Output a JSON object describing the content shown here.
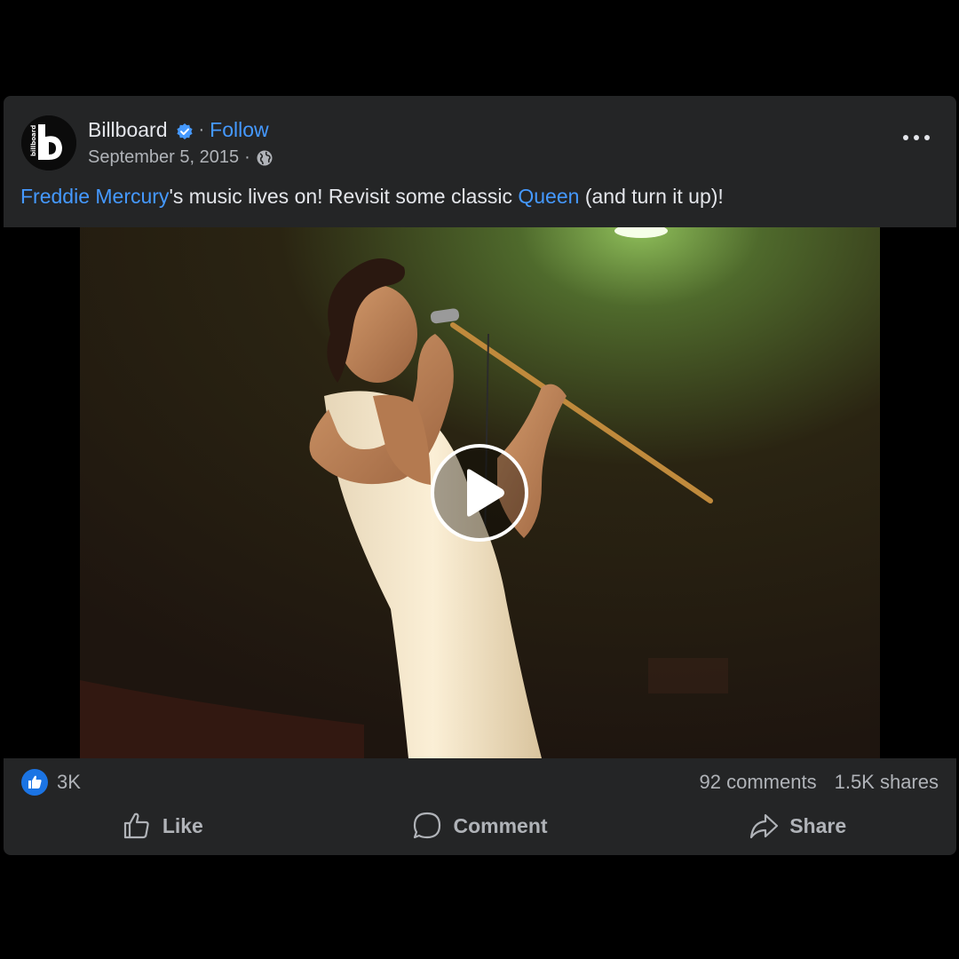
{
  "post": {
    "page_name": "Billboard",
    "follow_label": "Follow",
    "separator": "·",
    "date": "September 5, 2015",
    "avatar_text": "billboard",
    "caption": {
      "link1": "Freddie Mercury",
      "text1": "'s music lives on! Revisit some classic ",
      "link2": "Queen",
      "text2": " (and turn it up)!"
    }
  },
  "stats": {
    "reactions": "3K",
    "comments": "92 comments",
    "shares": "1.5K shares"
  },
  "actions": {
    "like": "Like",
    "comment": "Comment",
    "share": "Share"
  },
  "icons": {
    "verified": "verified-badge-icon",
    "privacy": "globe-icon",
    "more": "more-options-icon",
    "play": "play-icon",
    "reaction": "like-reaction-icon"
  },
  "colors": {
    "card_bg": "#242526",
    "accent": "#4599ff",
    "text_primary": "#e4e6eb",
    "text_secondary": "#b0b3b8"
  }
}
